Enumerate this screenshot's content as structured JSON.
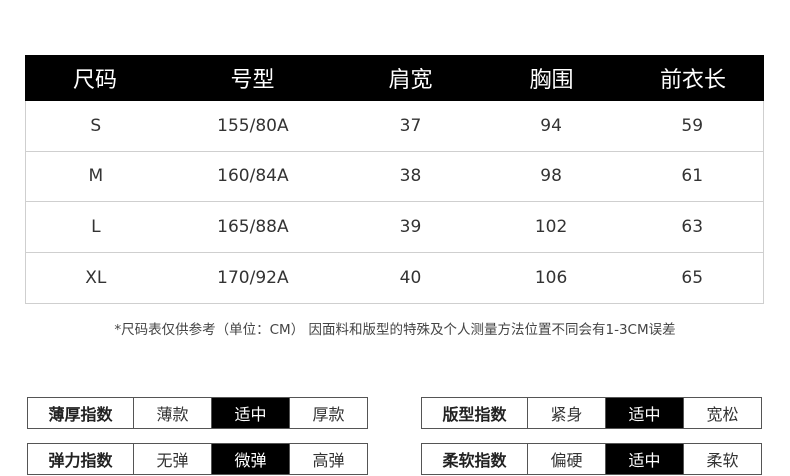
{
  "size_table": {
    "headers": [
      "尺码",
      "号型",
      "肩宽",
      "胸围",
      "前衣长"
    ],
    "rows": [
      [
        "S",
        "155/80A",
        "37",
        "94",
        "59"
      ],
      [
        "M",
        "160/84A",
        "38",
        "98",
        "61"
      ],
      [
        "L",
        "165/88A",
        "39",
        "102",
        "63"
      ],
      [
        "XL",
        "170/92A",
        "40",
        "106",
        "65"
      ]
    ]
  },
  "note": "*尺码表仅供参考（单位：CM） 因面料和版型的特殊及个人测量方法位置不同会有1-3CM误差",
  "indices": [
    {
      "label": "薄厚指数",
      "options": [
        "薄款",
        "适中",
        "厚款"
      ],
      "selected": 1
    },
    {
      "label": "版型指数",
      "options": [
        "紧身",
        "适中",
        "宽松"
      ],
      "selected": 1
    },
    {
      "label": "弹力指数",
      "options": [
        "无弹",
        "微弹",
        "高弹"
      ],
      "selected": 1
    },
    {
      "label": "柔软指数",
      "options": [
        "偏硬",
        "适中",
        "柔软"
      ],
      "selected": 1
    }
  ],
  "colors": {
    "header_bg": "#000000",
    "selected_bg": "#000000",
    "border": "#cfcfcf"
  }
}
